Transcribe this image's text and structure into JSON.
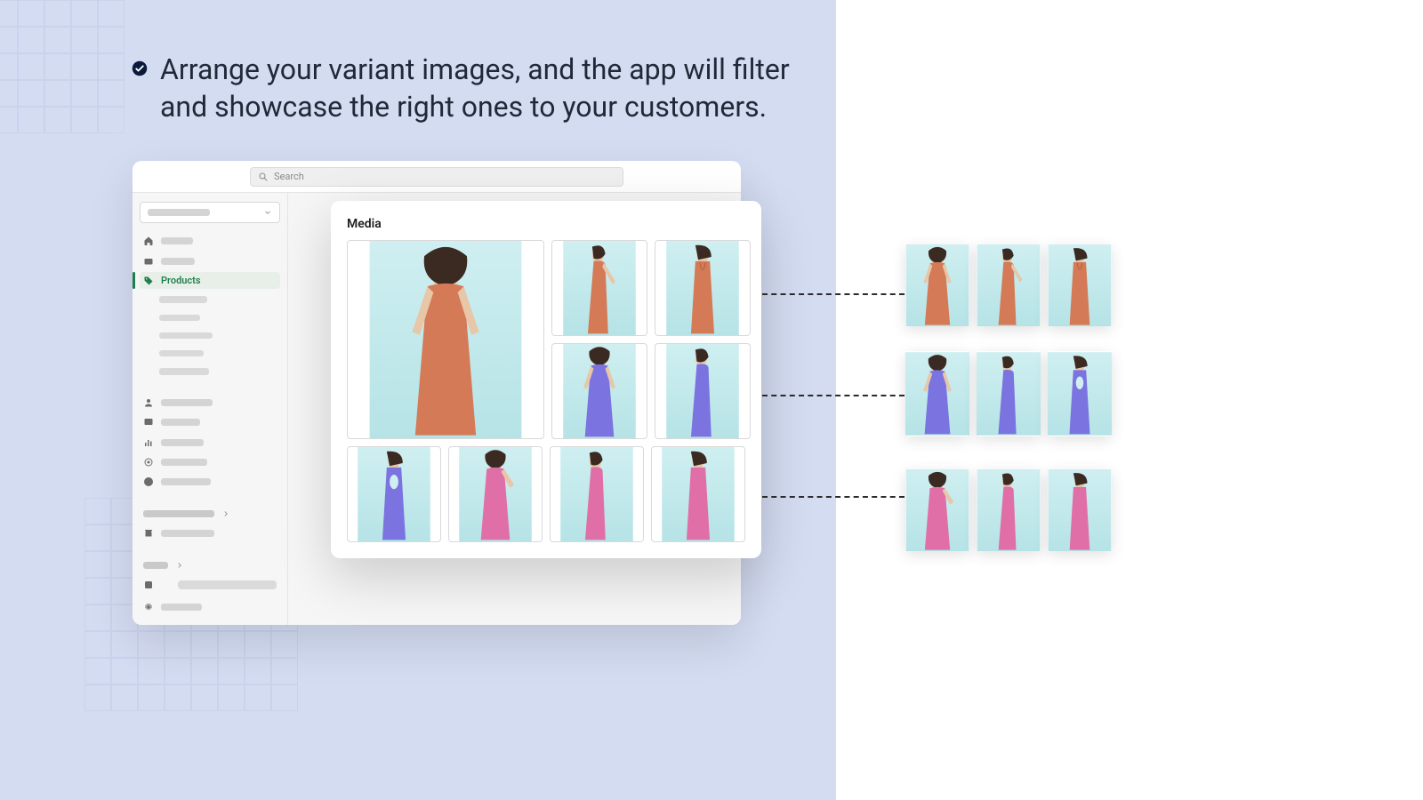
{
  "headline": "Arrange your variant images, and the app will filter and showcase the right ones to your customers.",
  "search": {
    "placeholder": "Search"
  },
  "sidebar": {
    "active_label": "Products"
  },
  "media": {
    "title": "Media"
  }
}
